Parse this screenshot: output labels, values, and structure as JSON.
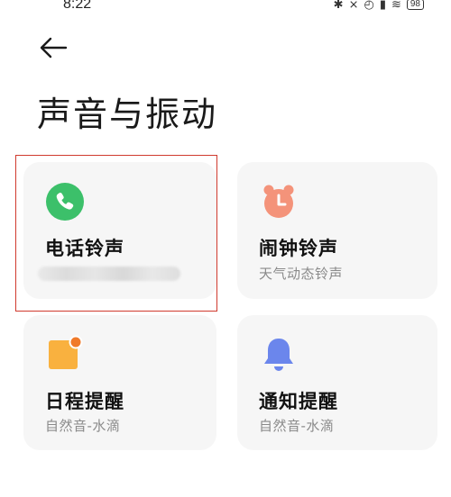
{
  "status_bar": {
    "time": "8:22",
    "icons": [
      "bluetooth-icon",
      "mute-icon",
      "alarm-icon",
      "signal-icon",
      "wifi-icon"
    ],
    "battery": "98"
  },
  "page": {
    "title": "声音与振动"
  },
  "cards": [
    {
      "title": "电话铃声",
      "subtitle": "",
      "icon": "phone-icon",
      "icon_color": "#3cc06a",
      "highlighted": true
    },
    {
      "title": "闹钟铃声",
      "subtitle": "天气动态铃声",
      "icon": "alarm-clock-icon",
      "icon_color": "#f4937a"
    },
    {
      "title": "日程提醒",
      "subtitle": "自然音-水滴",
      "icon": "calendar-note-icon",
      "icon_color": "#f9b13f"
    },
    {
      "title": "通知提醒",
      "subtitle": "自然音-水滴",
      "icon": "bell-icon",
      "icon_color": "#6b86ec"
    }
  ],
  "colors": {
    "highlight_frame": "#d03a2e",
    "card_bg": "#f6f6f6"
  }
}
